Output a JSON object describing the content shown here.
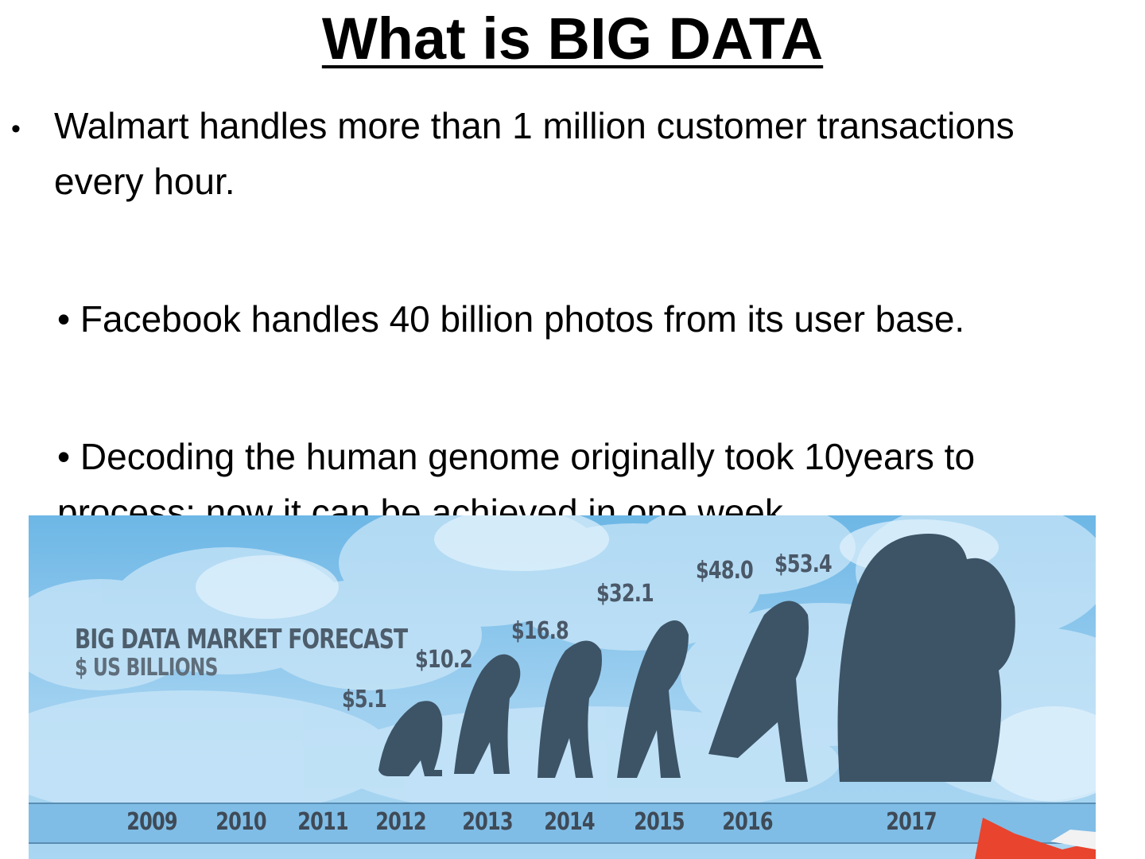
{
  "slide": {
    "title": "What is BIG DATA",
    "bullet_symbol": "•",
    "points": [
      "Walmart handles more than 1 million customer transactions every hour.",
      "• Facebook handles 40 billion photos from its user base.",
      "• Decoding the human genome originally took 10years to process; now it can be achieved in one week."
    ]
  },
  "points_display": {
    "p1_line1": "Walmart handles more than 1 million customer transactions",
    "p1_line2": "every hour.",
    "p2": "• Facebook handles 40 billion photos from its user base.",
    "p3_line1": "• Decoding the human genome originally took 10years to",
    "p3_line2": "process; now it can be achieved in one week."
  },
  "chart_data": {
    "type": "bar",
    "title": "BIG DATA MARKET FORECAST",
    "subtitle": "$ US BILLIONS",
    "categories": [
      "2009",
      "2010",
      "2011",
      "2012",
      "2013",
      "2014",
      "2015",
      "2016",
      "2017"
    ],
    "value_labels": [
      "",
      "",
      "",
      "$5.1",
      "$10.2",
      "$16.8",
      "$32.1",
      "$48.0",
      "$53.4"
    ],
    "values": [
      null,
      null,
      null,
      5.1,
      10.2,
      16.8,
      32.1,
      48.0,
      53.4
    ],
    "colors": {
      "sky": "#8cc8ee",
      "silhouette": "#3d5466",
      "label": "#4a5868"
    }
  }
}
